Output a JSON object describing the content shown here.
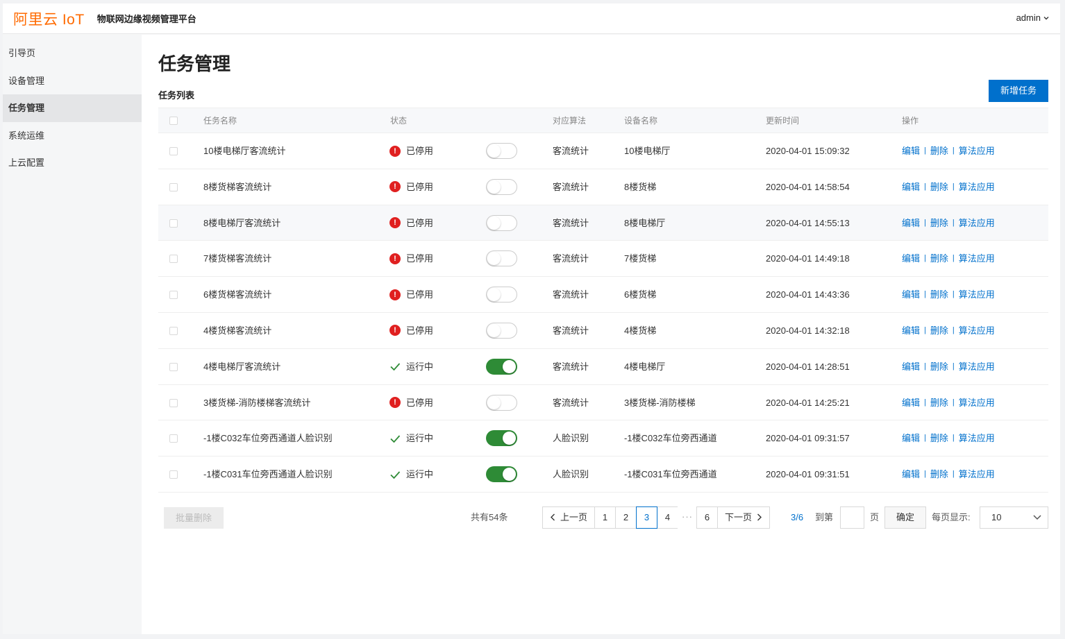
{
  "header": {
    "logo": "阿里云 IoT",
    "platform": "物联网边缘视频管理平台",
    "user": "admin"
  },
  "sidebar": {
    "items": [
      {
        "label": "引导页",
        "active": false
      },
      {
        "label": "设备管理",
        "active": false
      },
      {
        "label": "任务管理",
        "active": true
      },
      {
        "label": "系统运维",
        "active": false
      },
      {
        "label": "上云配置",
        "active": false
      }
    ]
  },
  "main": {
    "title": "任务管理",
    "list_title": "任务列表",
    "add_button": "新增任务"
  },
  "table": {
    "columns": {
      "name": "任务名称",
      "status": "状态",
      "algorithm": "对应算法",
      "device": "设备名称",
      "updated": "更新时间",
      "ops": "操作"
    },
    "ops_labels": {
      "edit": "编辑",
      "delete": "删除",
      "apply": "算法应用",
      "sep": "|"
    },
    "rows": [
      {
        "name": "10楼电梯厅客流统计",
        "status": "已停用",
        "running": false,
        "algorithm": "客流统计",
        "device": "10楼电梯厅",
        "updated": "2020-04-01 15:09:32"
      },
      {
        "name": "8楼货梯客流统计",
        "status": "已停用",
        "running": false,
        "algorithm": "客流统计",
        "device": "8楼货梯",
        "updated": "2020-04-01 14:58:54"
      },
      {
        "name": "8楼电梯厅客流统计",
        "status": "已停用",
        "running": false,
        "algorithm": "客流统计",
        "device": "8楼电梯厅",
        "updated": "2020-04-01 14:55:13"
      },
      {
        "name": "7楼货梯客流统计",
        "status": "已停用",
        "running": false,
        "algorithm": "客流统计",
        "device": "7楼货梯",
        "updated": "2020-04-01 14:49:18"
      },
      {
        "name": "6楼货梯客流统计",
        "status": "已停用",
        "running": false,
        "algorithm": "客流统计",
        "device": "6楼货梯",
        "updated": "2020-04-01 14:43:36"
      },
      {
        "name": "4楼货梯客流统计",
        "status": "已停用",
        "running": false,
        "algorithm": "客流统计",
        "device": "4楼货梯",
        "updated": "2020-04-01 14:32:18"
      },
      {
        "name": "4楼电梯厅客流统计",
        "status": "运行中",
        "running": true,
        "algorithm": "客流统计",
        "device": "4楼电梯厅",
        "updated": "2020-04-01 14:28:51"
      },
      {
        "name": "3楼货梯-消防楼梯客流统计",
        "status": "已停用",
        "running": false,
        "algorithm": "客流统计",
        "device": "3楼货梯-消防楼梯",
        "updated": "2020-04-01 14:25:21"
      },
      {
        "name": "-1楼C032车位旁西通道人脸识别",
        "status": "运行中",
        "running": true,
        "algorithm": "人脸识别",
        "device": "-1楼C032车位旁西通道",
        "updated": "2020-04-01 09:31:57"
      },
      {
        "name": "-1楼C031车位旁西通道人脸识别",
        "status": "运行中",
        "running": true,
        "algorithm": "人脸识别",
        "device": "-1楼C031车位旁西通道",
        "updated": "2020-04-01 09:31:51"
      }
    ]
  },
  "footer": {
    "batch_delete": "批量删除",
    "total": "共有54条",
    "prev": "上一页",
    "next": "下一页",
    "pages": [
      "1",
      "2",
      "3",
      "4"
    ],
    "current_page": "3",
    "ellipsis": "···",
    "last_page": "6",
    "page_info": "3/6",
    "goto_label": "到第",
    "page_label": "页",
    "confirm": "确定",
    "per_page_label": "每页显示:",
    "per_page_value": "10"
  },
  "colors": {
    "brand": "#ff6a00",
    "primary": "#0070cc",
    "danger": "#e02020",
    "success": "#2e8b36"
  }
}
